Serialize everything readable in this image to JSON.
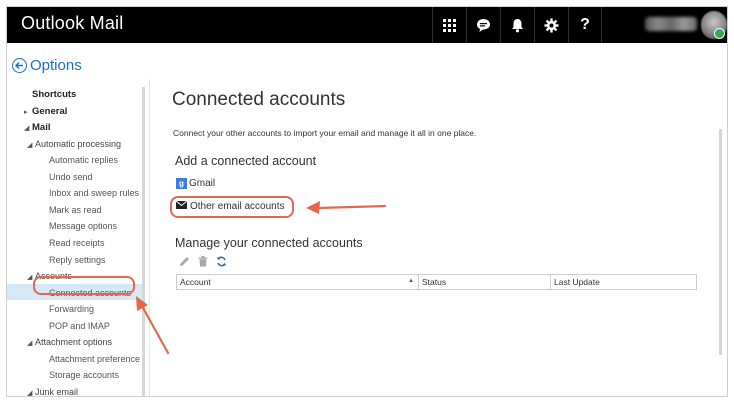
{
  "app": {
    "title": "Outlook Mail"
  },
  "topbar": {
    "icons": [
      "apps-grid-icon",
      "chat-icon",
      "bell-icon",
      "gear-icon",
      "help-icon"
    ],
    "help_label": "?"
  },
  "options": {
    "label": "Options"
  },
  "sidebar": {
    "items": [
      {
        "label": "Shortcuts",
        "level": 0
      },
      {
        "label": "General",
        "level": 0,
        "caret": "▸"
      },
      {
        "label": "Mail",
        "level": 0,
        "caret": "◢"
      },
      {
        "label": "Automatic processing",
        "level": 1,
        "caret": "◢"
      },
      {
        "label": "Automatic replies",
        "level": 2
      },
      {
        "label": "Undo send",
        "level": 2
      },
      {
        "label": "Inbox and sweep rules",
        "level": 2
      },
      {
        "label": "Mark as read",
        "level": 2
      },
      {
        "label": "Message options",
        "level": 2
      },
      {
        "label": "Read receipts",
        "level": 2
      },
      {
        "label": "Reply settings",
        "level": 2
      },
      {
        "label": "Accounts",
        "level": 1,
        "caret": "◢"
      },
      {
        "label": "Connected accounts",
        "level": 2,
        "selected": true
      },
      {
        "label": "Forwarding",
        "level": 2
      },
      {
        "label": "POP and IMAP",
        "level": 2
      },
      {
        "label": "Attachment options",
        "level": 1,
        "caret": "◢"
      },
      {
        "label": "Attachment preference",
        "level": 2
      },
      {
        "label": "Storage accounts",
        "level": 2
      },
      {
        "label": "Junk email",
        "level": 1,
        "caret": "◢"
      }
    ]
  },
  "main": {
    "title": "Connected accounts",
    "intro": "Connect your other accounts to import your email and manage it all in one place.",
    "add_heading": "Add a connected account",
    "gmail_badge": "g",
    "gmail_label": "Gmail",
    "other_label": "Other email accounts",
    "manage_heading": "Manage your connected accounts",
    "table_headers": [
      "Account",
      "Status",
      "Last Update"
    ]
  },
  "colors": {
    "accent": "#1a6fc2",
    "annotation": "#e0694f",
    "selected_row": "#d7e9f6",
    "topbar": "#000000"
  }
}
